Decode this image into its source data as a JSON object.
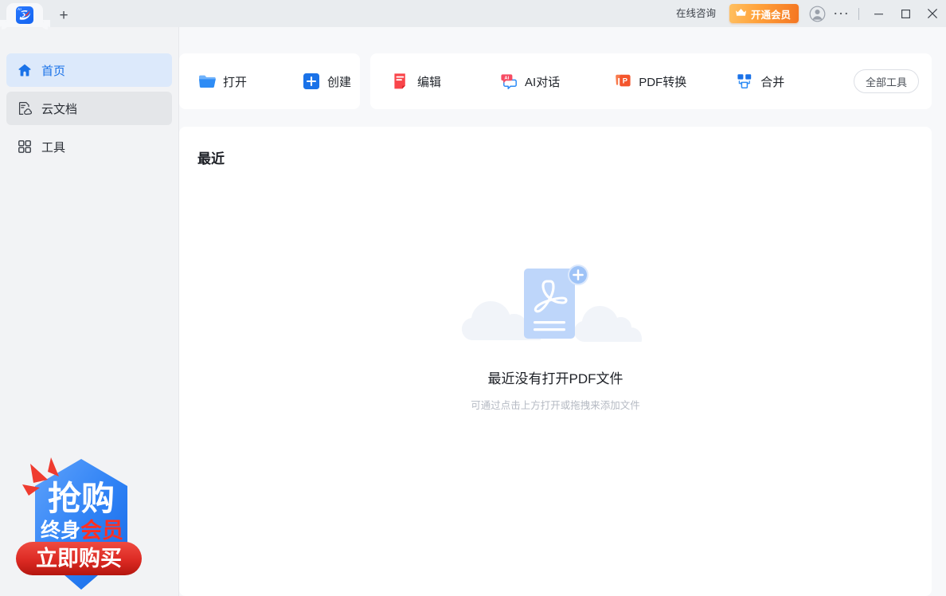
{
  "titlebar": {
    "tab": {
      "icon": "app-logo-icon",
      "title": ""
    },
    "new_tab_label": "+",
    "consult_label": "在线咨询",
    "vip_label": "开通会员",
    "vip_icon": "crown-icon",
    "avatar_icon": "user-avatar-icon",
    "more_label": "···",
    "minimize_icon": "minimize-icon",
    "maximize_icon": "maximize-icon",
    "close_icon": "close-icon"
  },
  "sidebar": {
    "items": [
      {
        "label": "首页",
        "icon": "home-icon",
        "state": "active"
      },
      {
        "label": "云文档",
        "icon": "cloud-document-icon",
        "state": "hover"
      },
      {
        "label": "工具",
        "icon": "grid-tools-icon",
        "state": "normal"
      }
    ],
    "promo": {
      "line1": "抢购",
      "line2_a": "终身",
      "line2_b": "会员",
      "button": "立即购买",
      "badge_color": "#2f82f5",
      "accent_color": "#e03127"
    }
  },
  "toolbar": {
    "group_primary": [
      {
        "label": "打开",
        "icon": "folder-open-icon"
      },
      {
        "label": "创建",
        "icon": "create-plus-icon"
      }
    ],
    "group_secondary": [
      {
        "label": "编辑",
        "icon": "edit-document-icon"
      },
      {
        "label": "AI对话",
        "icon": "ai-chat-icon"
      },
      {
        "label": "PDF转换",
        "icon": "pdf-convert-icon"
      },
      {
        "label": "合并",
        "icon": "merge-icon"
      }
    ],
    "all_tools_label": "全部工具"
  },
  "main": {
    "recent_title": "最近",
    "empty_state": {
      "illustration": "pdf-add-document-icon",
      "title": "最近没有打开PDF文件",
      "subtitle": "可通过点击上方打开或拖拽来添加文件"
    }
  },
  "colors": {
    "accent_blue": "#1a72e8",
    "titlebar_bg": "#e9ecef",
    "sidebar_bg": "#f2f3f5",
    "content_bg": "#f7f8fa",
    "card_bg": "#ffffff",
    "vip_orange": "#f47521",
    "edit_red": "#f9454a"
  }
}
